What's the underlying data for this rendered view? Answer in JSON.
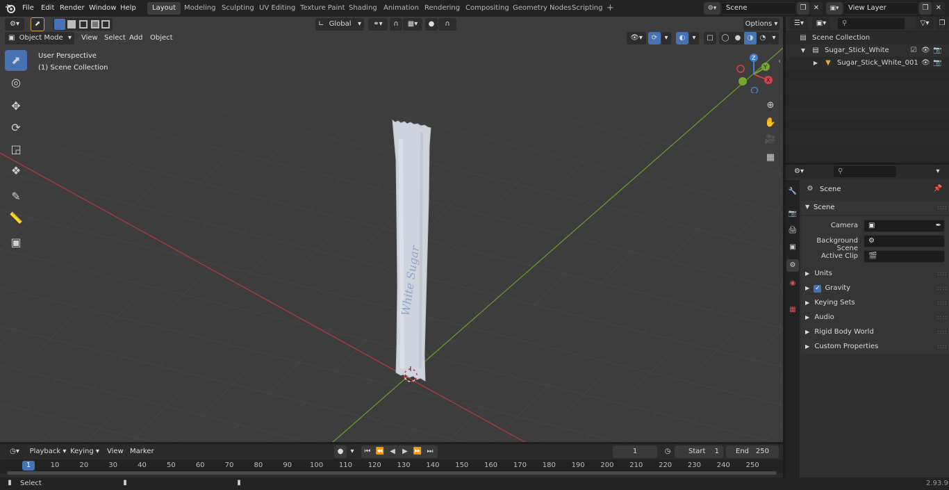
{
  "topbar": {
    "menus": [
      "File",
      "Edit",
      "Render",
      "Window",
      "Help"
    ],
    "workspaces": [
      "Layout",
      "Modeling",
      "Sculpting",
      "UV Editing",
      "Texture Paint",
      "Shading",
      "Animation",
      "Rendering",
      "Compositing",
      "Geometry Nodes",
      "Scripting"
    ],
    "add_tab": "+",
    "scene": "Scene",
    "view_layer": "View Layer"
  },
  "viewport": {
    "mode": "Object Mode",
    "menus": [
      "View",
      "Select",
      "Add",
      "Object"
    ],
    "orientation": "Global",
    "options": "Options",
    "info_line1": "User Perspective",
    "info_line2": "(1) Scene Collection",
    "object_label": "White Sugar",
    "gizmo": {
      "z": "Z",
      "y": "Y",
      "x": "X"
    }
  },
  "outliner": {
    "root": "Scene Collection",
    "items": [
      {
        "label": "Sugar_Stick_White"
      },
      {
        "label": "Sugar_Stick_White_001"
      }
    ]
  },
  "properties": {
    "title": "Scene",
    "section": "Scene",
    "fields": [
      {
        "label": "Camera"
      },
      {
        "label": "Background Scene"
      },
      {
        "label": "Active Clip"
      }
    ],
    "panels": [
      "Units",
      "Gravity",
      "Keying Sets",
      "Audio",
      "Rigid Body World",
      "Custom Properties"
    ]
  },
  "timeline": {
    "menus": [
      "Playback",
      "Keying",
      "View",
      "Marker"
    ],
    "current_frame": "1",
    "start_label": "Start",
    "start": "1",
    "end_label": "End",
    "end": "250",
    "ruler": [
      "10",
      "20",
      "30",
      "40",
      "50",
      "60",
      "70",
      "80",
      "90",
      "100",
      "110",
      "120",
      "130",
      "140",
      "150",
      "160",
      "170",
      "180",
      "190",
      "200",
      "210",
      "220",
      "230",
      "240",
      "250"
    ],
    "playhead": "1"
  },
  "statusbar": {
    "select": "Select",
    "version": "2.93.9"
  },
  "colors": {
    "x_axis": "#b0393f",
    "y_axis": "#6a9a2c",
    "active_tab": "#3d3d3d",
    "accent": "#4772b3"
  }
}
